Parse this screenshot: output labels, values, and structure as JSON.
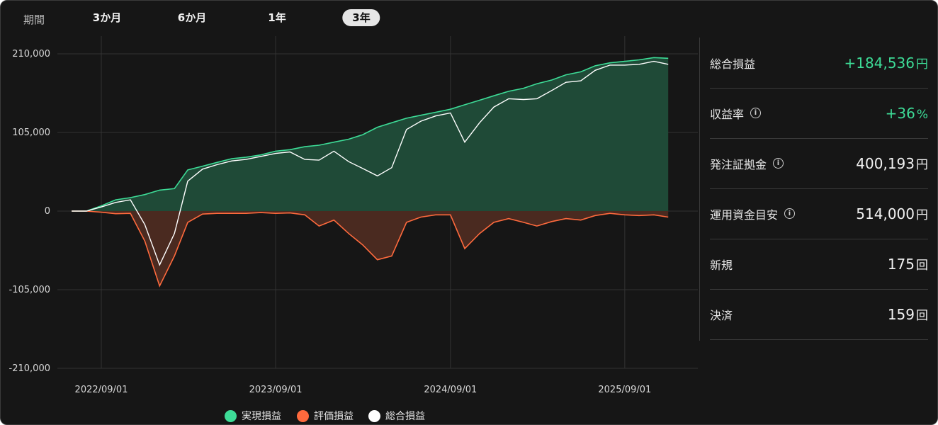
{
  "period": {
    "label": "期間",
    "options": [
      "3か月",
      "6か月",
      "1年",
      "3年"
    ],
    "selected": "3年"
  },
  "colors": {
    "realized": "#3ddc97",
    "realized_fill": "#1f4a37",
    "unrealized": "#ff6a3d",
    "unrealized_fill": "#4a2a20",
    "total": "#ffffff"
  },
  "chart_data": {
    "type": "area",
    "y_ticks": [
      "210,000",
      "105,000",
      "0",
      "-105,000",
      "-210,000"
    ],
    "ylim": [
      -210000,
      210000
    ],
    "x_ticks": [
      "2022/09/01",
      "2023/09/01",
      "2024/09/01",
      "2025/09/01"
    ],
    "xlim": [
      "2022/06/01",
      "2026/02/01"
    ],
    "x": [
      "2022/07/01",
      "2022/08/01",
      "2022/09/01",
      "2022/10/01",
      "2022/11/01",
      "2022/12/01",
      "2023/01/01",
      "2023/02/01",
      "2023/03/01",
      "2023/04/01",
      "2023/05/01",
      "2023/06/01",
      "2023/07/01",
      "2023/08/01",
      "2023/09/01",
      "2023/10/01",
      "2023/11/01",
      "2023/12/01",
      "2024/01/01",
      "2024/02/01",
      "2024/03/01",
      "2024/04/01",
      "2024/05/01",
      "2024/06/01",
      "2024/07/01",
      "2024/08/01",
      "2024/09/01",
      "2024/10/01",
      "2024/11/01",
      "2024/12/01",
      "2025/01/01",
      "2025/02/01",
      "2025/03/01",
      "2025/04/01",
      "2025/05/01",
      "2025/06/01",
      "2025/07/01",
      "2025/08/01",
      "2025/09/01",
      "2025/10/01",
      "2025/11/01",
      "2025/12/01"
    ],
    "series": [
      {
        "name": "実現損益",
        "values": [
          0,
          0,
          7000,
          15000,
          18000,
          22000,
          28000,
          30000,
          55000,
          60000,
          65000,
          70000,
          72000,
          75000,
          80000,
          82000,
          86000,
          88000,
          92000,
          96000,
          102000,
          112000,
          118000,
          124000,
          128000,
          132000,
          136000,
          142000,
          148000,
          154000,
          160000,
          164000,
          170000,
          175000,
          182000,
          186000,
          194000,
          198000,
          200000,
          202000,
          205000,
          204000
        ]
      },
      {
        "name": "評価損益",
        "values": [
          0,
          0,
          -1500,
          -3500,
          -3000,
          -40000,
          -100000,
          -60000,
          -15000,
          -4000,
          -3000,
          -3000,
          -3000,
          -2000,
          -3000,
          -2500,
          -5000,
          -20000,
          -12000,
          -30000,
          -45000,
          -65000,
          -60000,
          -15000,
          -8000,
          -5000,
          -5000,
          -50000,
          -30000,
          -15000,
          -10000,
          -15000,
          -20000,
          -14000,
          -10000,
          -12000,
          -6000,
          -3000,
          -5000,
          -6000,
          -5000,
          -8000
        ]
      },
      {
        "name": "総合損益",
        "values": [
          0,
          0,
          5500,
          11500,
          15000,
          -18000,
          -72000,
          -30000,
          40000,
          56000,
          62000,
          67000,
          69000,
          73000,
          77000,
          79000,
          69000,
          68000,
          80000,
          66000,
          57000,
          47000,
          58000,
          109000,
          120000,
          127000,
          131000,
          92000,
          118000,
          139000,
          150000,
          149000,
          150000,
          161000,
          172000,
          174000,
          188000,
          195000,
          195000,
          196000,
          200000,
          196000
        ]
      }
    ]
  },
  "stats": [
    {
      "label": "総合損益",
      "value": "+184,536",
      "unit": "円",
      "positive": true,
      "info": false
    },
    {
      "label": "収益率",
      "value": "+36",
      "unit": "%",
      "positive": true,
      "info": true
    },
    {
      "label": "発注証拠金",
      "value": "400,193",
      "unit": "円",
      "positive": false,
      "info": true
    },
    {
      "label": "運用資金目安",
      "value": "514,000",
      "unit": "円",
      "positive": false,
      "info": true
    },
    {
      "label": "新規",
      "value": "175",
      "unit": "回",
      "positive": false,
      "info": false
    },
    {
      "label": "決済",
      "value": "159",
      "unit": "回",
      "positive": false,
      "info": false
    }
  ]
}
